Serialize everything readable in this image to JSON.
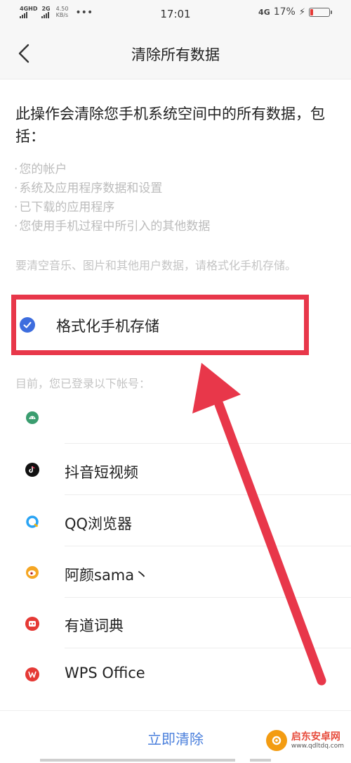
{
  "status_bar": {
    "net1": "4GHD",
    "net2": "2G",
    "speed": "4.50",
    "speed_unit": "KB/s",
    "time": "17:01",
    "net3": "4G",
    "battery": "17%",
    "battery_level_percent": 17
  },
  "nav": {
    "title": "清除所有数据"
  },
  "description": "此操作会清除您手机系统空间中的所有数据，包括：",
  "bullets": [
    "您的帐户",
    "系统及应用程序数据和设置",
    "已下载的应用程序",
    "您使用手机过程中所引入的其他数据"
  ],
  "hint": "要清空音乐、图片和其他用户数据，请格式化手机存储。",
  "format_option": {
    "label": "格式化手机存储",
    "checked": true
  },
  "accounts_label": "目前，您已登录以下帐号：",
  "accounts": [
    {
      "name": "",
      "icon": "android-icon",
      "color": "#3a9d6f"
    },
    {
      "name": "抖音短视频",
      "icon": "douyin-icon",
      "color": "#111111"
    },
    {
      "name": "QQ浏览器",
      "icon": "qq-browser-icon",
      "color": "#2aa4f4"
    },
    {
      "name": "阿颜sama丶",
      "icon": "weibo-icon",
      "color": "#f5a623"
    },
    {
      "name": "有道词典",
      "icon": "youdao-icon",
      "color": "#e53935"
    },
    {
      "name": "WPS Office",
      "icon": "wps-icon",
      "color": "#e53935"
    }
  ],
  "bottom": {
    "clear_button": "立即清除"
  },
  "watermark": {
    "name": "启东安卓网",
    "url": "www.qdltdq.com"
  },
  "colors": {
    "accent": "#4a7fdc",
    "check": "#3d6dde",
    "annotation": "#e8374a"
  }
}
